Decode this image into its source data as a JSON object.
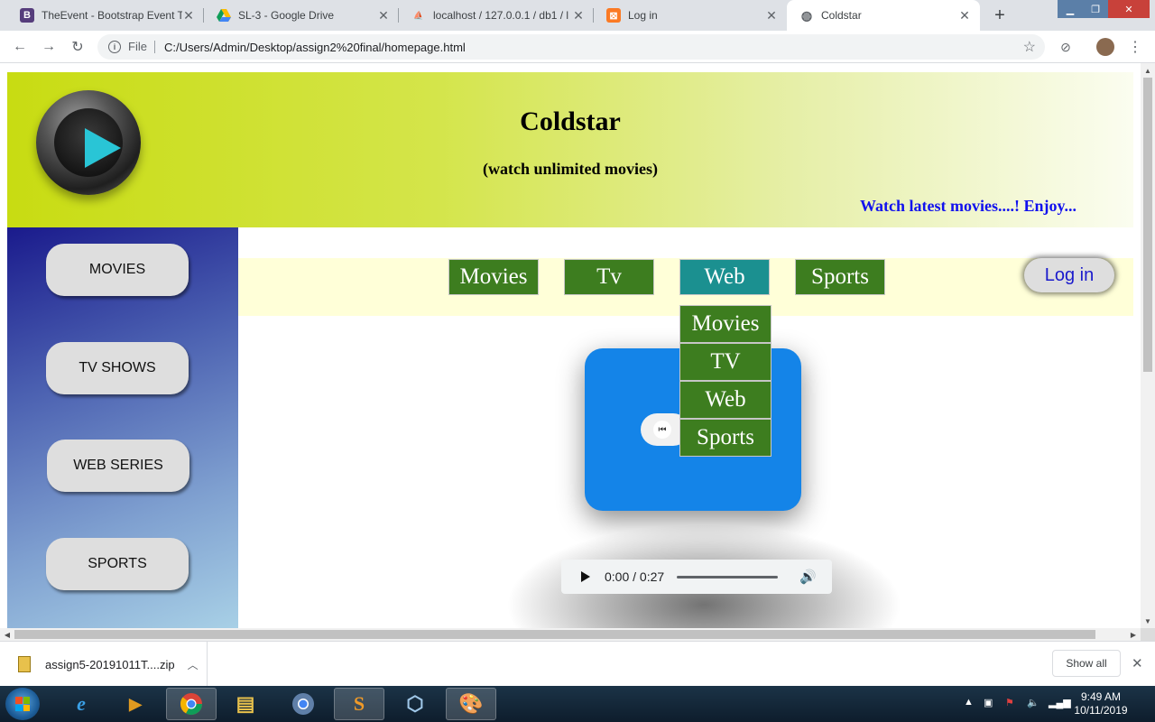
{
  "browser": {
    "tabs": [
      {
        "label": "TheEvent - Bootstrap Event T",
        "favicon": "bootstrap-icon"
      },
      {
        "label": "SL-3 - Google Drive",
        "favicon": "google-drive-icon"
      },
      {
        "label": "localhost / 127.0.0.1 / db1 / l",
        "favicon": "phpmyadmin-icon"
      },
      {
        "label": "Log in",
        "favicon": "xampp-icon"
      },
      {
        "label": "Coldstar",
        "favicon": "globe-icon",
        "active": true
      }
    ],
    "address": {
      "scheme_label": "File",
      "url": "C:/Users/Admin/Desktop/assign2%20final/homepage.html"
    }
  },
  "page": {
    "header": {
      "title": "Coldstar",
      "subtitle": "(watch unlimited movies)",
      "marquee": "Watch latest movies....! Enjoy..."
    },
    "sidebar": {
      "items": [
        {
          "label": "MOVIES"
        },
        {
          "label": "TV SHOWS"
        },
        {
          "label": "WEB SERIES"
        },
        {
          "label": "SPORTS"
        }
      ]
    },
    "nav": {
      "items": [
        {
          "label": "Movies"
        },
        {
          "label": "Tv"
        },
        {
          "label": "Web",
          "hovered": true
        },
        {
          "label": "Sports"
        }
      ],
      "login_label": "Log in"
    },
    "dropdown": {
      "items": [
        {
          "label": "Movies"
        },
        {
          "label": "TV"
        },
        {
          "label": "Web"
        },
        {
          "label": "Sports"
        }
      ]
    },
    "audio": {
      "time": "0:00 / 0:27"
    }
  },
  "downloads": {
    "file": "assign5-20191011T....zip",
    "show_all": "Show all"
  },
  "taskbar": {
    "time": "9:49 AM",
    "date": "10/11/2019"
  },
  "colors": {
    "header_start": "#c8dc12",
    "nav_green": "#3d7d1f",
    "nav_hover": "#1b9090",
    "player_blue": "#1484e8",
    "marquee_text": "#1111ee",
    "nav_bar_bg": "#ffffd8"
  }
}
